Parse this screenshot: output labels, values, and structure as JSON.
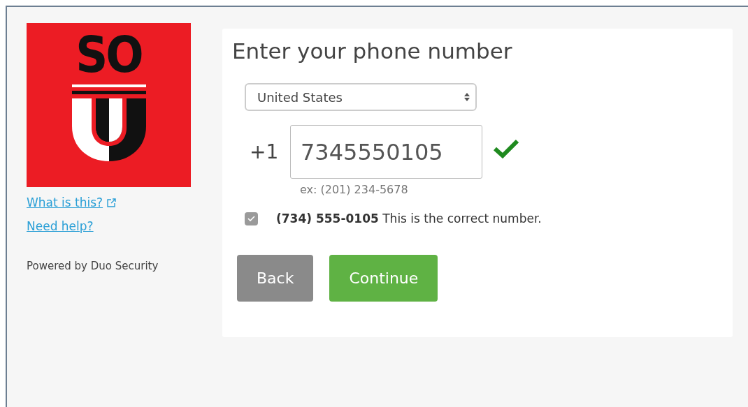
{
  "logo": {
    "text": "SO"
  },
  "sidebar": {
    "links": [
      {
        "label": "What is this?",
        "external": true
      },
      {
        "label": "Need help?",
        "external": false
      }
    ],
    "footer": "Powered by Duo Security"
  },
  "form": {
    "title": "Enter your phone number",
    "country": {
      "value": "United States"
    },
    "phone": {
      "prefix": "+1",
      "value": "7345550105",
      "valid": true,
      "hint": "ex: (201) 234-5678"
    },
    "confirm": {
      "checked": true,
      "disabled": true,
      "label": "**(734) 555-0105** This is the correct number."
    },
    "buttons": [
      {
        "label": "Back",
        "kind": "secondary"
      },
      {
        "label": "Continue",
        "kind": "primary"
      }
    ]
  }
}
